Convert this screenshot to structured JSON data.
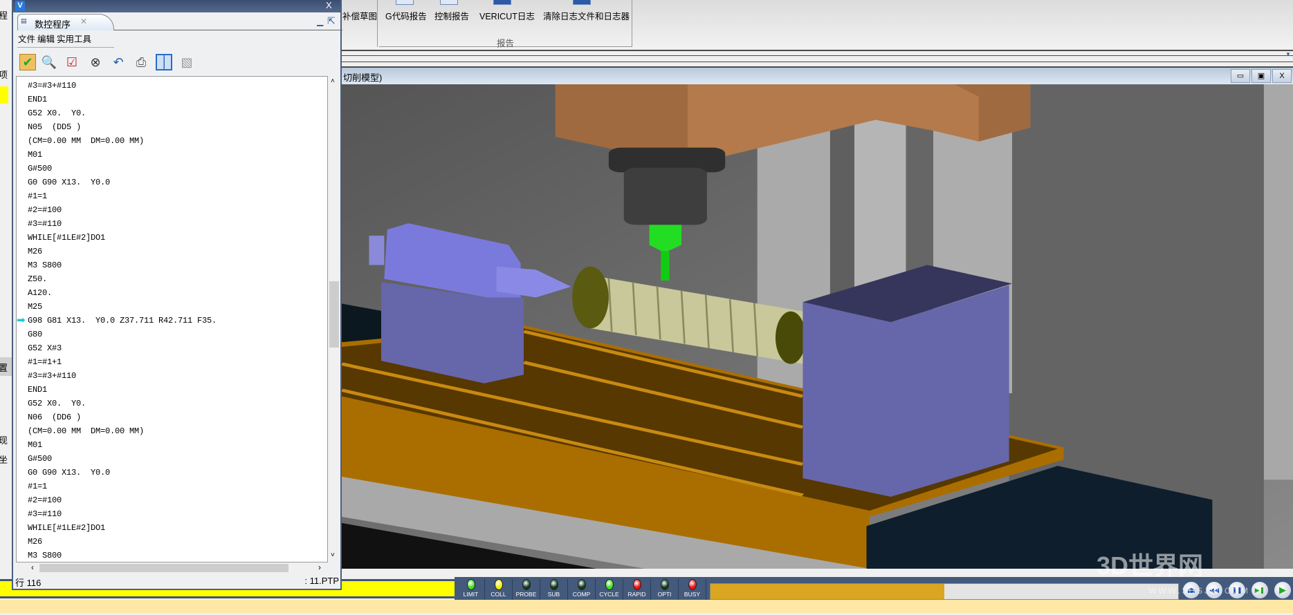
{
  "ribbon": {
    "partial_label": "补偿草图",
    "items": [
      {
        "label": "G代码报告"
      },
      {
        "label": "控制报告"
      },
      {
        "label": "VERICUT日志"
      },
      {
        "label": "清除日志文件和日志器"
      }
    ],
    "group_label": "报告"
  },
  "left_strip": {
    "chars": [
      "程",
      "项",
      "置",
      "现",
      "坐"
    ]
  },
  "viewport": {
    "title": "切削模型)",
    "buttons": [
      "minimize",
      "restore",
      "close"
    ]
  },
  "panel": {
    "tab_label": "数控程序",
    "menu": [
      "文件",
      "编辑",
      "实用工具"
    ],
    "toolbar": [
      "clipboard-check-icon",
      "nc-search-icon",
      "nc-checklist-icon",
      "binoculars-icon",
      "undo-icon",
      "print-icon",
      "split-view-icon",
      "nc-disabled-icon"
    ],
    "code_lines": [
      "#3=#3+#110",
      "END1",
      "G52 X0.  Y0.",
      "N05  (DD5 )",
      "(CM=0.00 MM  DM=0.00 MM)",
      "M01",
      "G#500",
      "G0 G90 X13.  Y0.0",
      "#1=1",
      "#2=#100",
      "#3=#110",
      "WHILE[#1LE#2]DO1",
      "M26",
      "M3 S800",
      "Z50.",
      "A120.",
      "M25",
      "G98 G81 X13.  Y0.0 Z37.711 R42.711 F35.",
      "G80",
      "G52 X#3",
      "#1=#1+1",
      "#3=#3+#110",
      "END1",
      "G52 X0.  Y0.",
      "N06  (DD6 )",
      "(CM=0.00 MM  DM=0.00 MM)",
      "M01",
      "G#500",
      "G0 G90 X13.  Y0.0",
      "#1=1",
      "#2=#100",
      "#3=#110",
      "WHILE[#1LE#2]DO1",
      "M26",
      "M3 S800"
    ],
    "current_line_index": 17,
    "status_line": "行 116",
    "status_file": ": 11.PTP"
  },
  "indicators": [
    {
      "label": "LIMIT",
      "color": "#44dd22"
    },
    {
      "label": "COLL",
      "color": "#eeee00"
    },
    {
      "label": "PROBE",
      "color": "#0e3a1a"
    },
    {
      "label": "SUB",
      "color": "#0e3a1a"
    },
    {
      "label": "COMP",
      "color": "#0e3a1a"
    },
    {
      "label": "CYCLE",
      "color": "#44dd22"
    },
    {
      "label": "RAPID",
      "color": "#ee1111"
    },
    {
      "label": "OPTI",
      "color": "#0e3a1a"
    },
    {
      "label": "BUSY",
      "color": "#ee1111"
    }
  ],
  "progress": 0.5,
  "playback": [
    {
      "name": "eject",
      "glyph": "⏏",
      "color": "#1a4fb0"
    },
    {
      "name": "rewind",
      "glyph": "◀◀",
      "color": "#1a4fb0"
    },
    {
      "name": "pause",
      "glyph": "❚❚",
      "color": "#1a4fb0"
    },
    {
      "name": "step",
      "glyph": "▶❚",
      "color": "#22aa22"
    },
    {
      "name": "play",
      "glyph": "▶",
      "color": "#22aa22"
    }
  ],
  "watermark": {
    "text": "3D世界网",
    "url": "WWW.3DSJW.COM"
  }
}
